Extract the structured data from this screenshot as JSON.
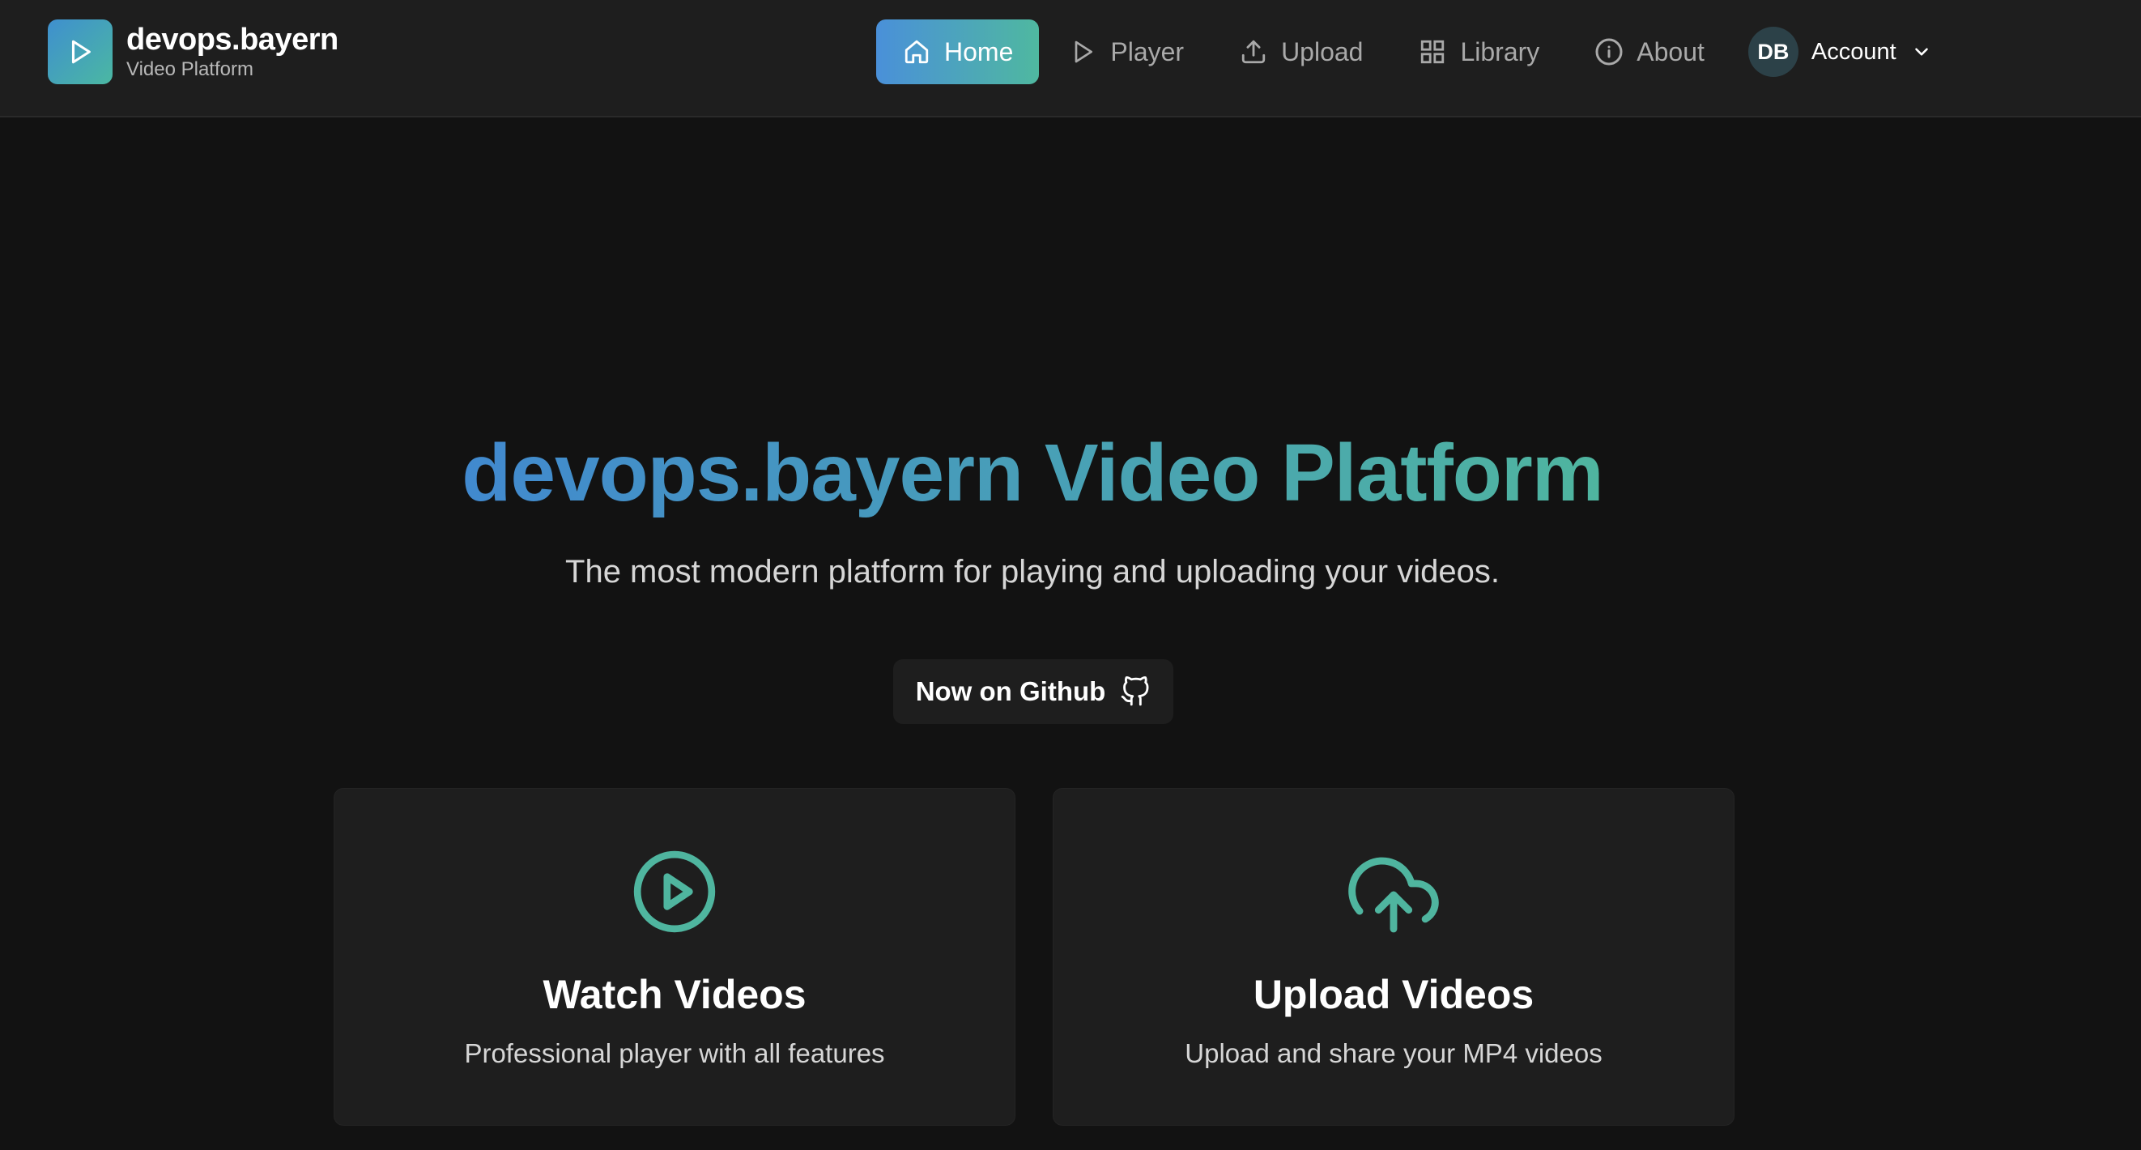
{
  "brand": {
    "name": "devops.bayern",
    "subtitle": "Video Platform",
    "logo_icon": "play-icon"
  },
  "nav": {
    "items": [
      {
        "label": "Home",
        "icon": "home-icon",
        "active": true
      },
      {
        "label": "Player",
        "icon": "play-icon",
        "active": false
      },
      {
        "label": "Upload",
        "icon": "upload-icon",
        "active": false
      },
      {
        "label": "Library",
        "icon": "grid-icon",
        "active": false
      },
      {
        "label": "About",
        "icon": "info-icon",
        "active": false
      }
    ],
    "account": {
      "initials": "DB",
      "label": "Account",
      "icon": "chevron-down-icon"
    }
  },
  "hero": {
    "title": "devops.bayern Video Platform",
    "subtitle": "The most modern platform for playing and uploading your videos.",
    "github_button": "Now on Github",
    "github_icon": "github-icon"
  },
  "cards": [
    {
      "title": "Watch Videos",
      "description": "Professional player with all features",
      "icon": "play-circle-icon"
    },
    {
      "title": "Upload Videos",
      "description": "Upload and share your MP4 videos",
      "icon": "cloud-upload-icon"
    }
  ],
  "colors": {
    "background": "#121212",
    "surface": "#1e1e1e",
    "accent_blue": "#4a90d9",
    "accent_teal": "#4fb59f",
    "muted_text": "#a9a9a9"
  }
}
